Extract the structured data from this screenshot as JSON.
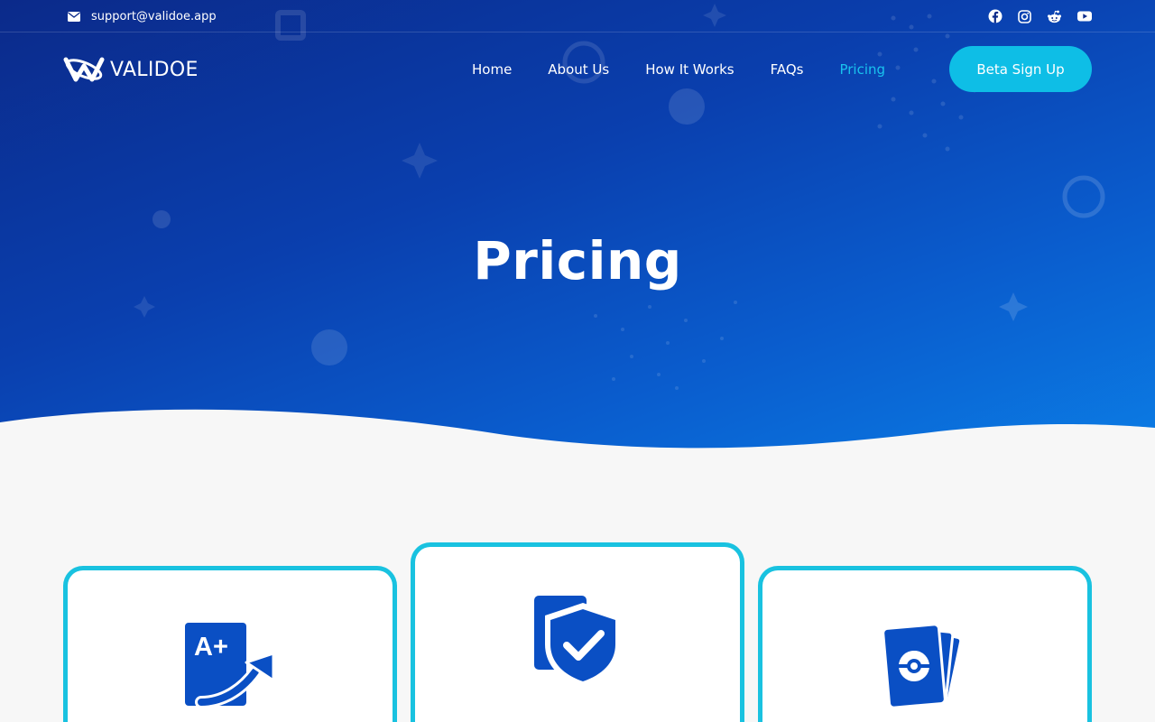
{
  "topbar": {
    "email": "support@validoe.app",
    "social": [
      {
        "name": "facebook-icon"
      },
      {
        "name": "instagram-icon"
      },
      {
        "name": "reddit-icon"
      },
      {
        "name": "youtube-icon"
      }
    ]
  },
  "brand": {
    "name": "VALIDOE"
  },
  "nav": {
    "items": [
      {
        "label": "Home"
      },
      {
        "label": "About Us"
      },
      {
        "label": "How It Works"
      },
      {
        "label": "FAQs"
      },
      {
        "label": "Pricing"
      }
    ],
    "active": "Pricing",
    "cta": "Beta Sign Up"
  },
  "hero": {
    "title": "Pricing"
  },
  "cards": [
    {
      "icon": "grade-upgrade-icon",
      "glyph": "A+"
    },
    {
      "icon": "shield-check-icon"
    },
    {
      "icon": "trading-cards-icon"
    }
  ],
  "colors": {
    "accent": "#0ebee6",
    "card_border": "#19c2e0",
    "icon_blue": "#0a4fc4",
    "hero_dark": "#0b2a8a",
    "hero_light": "#0b7ee6",
    "background": "#f7f7f7"
  }
}
